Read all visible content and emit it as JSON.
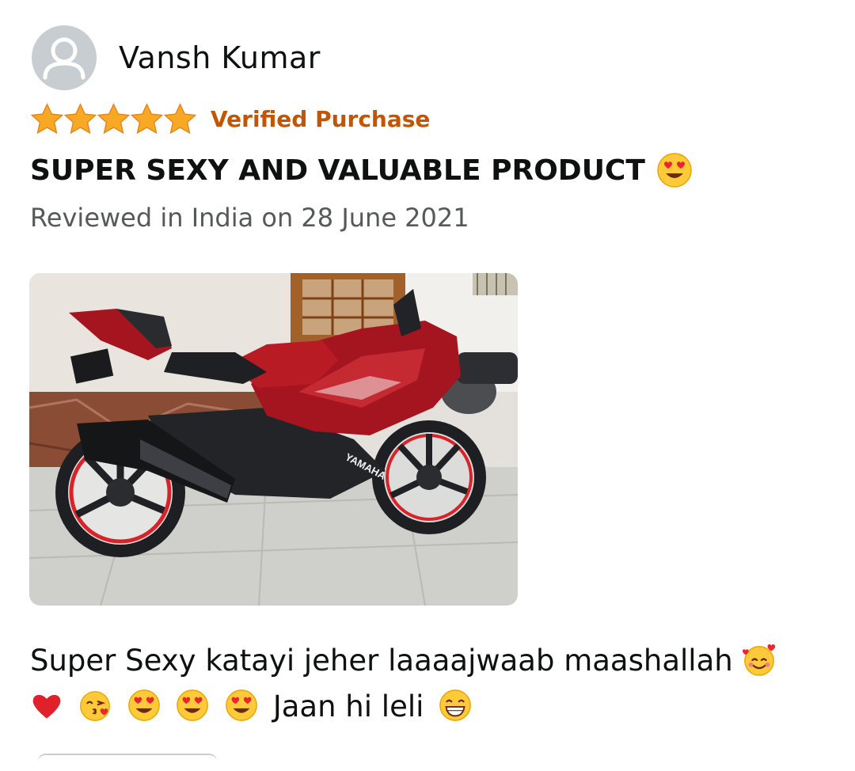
{
  "reviewer": {
    "name": "Vansh Kumar",
    "avatar_icon": "user-placeholder-icon"
  },
  "rating": {
    "stars": 5,
    "max": 5,
    "star_color": "#f5a623",
    "verified_label": "Verified Purchase",
    "verified_color": "#c45500"
  },
  "review": {
    "title": "SUPER SEXY AND VALUABLE PRODUCT",
    "title_emoji": "heart-eyes-emoji",
    "date": "Reviewed in India on 28 June 2021",
    "photo": {
      "subject": "red sport motorcycle photo",
      "badge_text": "YAMAHA"
    },
    "body_line1": "Super Sexy katayi jeher laaaajwaab maashallah",
    "body_line2": "Jaan hi leli",
    "emojis": [
      "smiling-face-with-hearts-emoji",
      "red-heart-emoji",
      "kissing-face-emoji",
      "heart-eyes-emoji",
      "heart-eyes-emoji",
      "heart-eyes-emoji",
      "grinning-face-emoji"
    ]
  }
}
